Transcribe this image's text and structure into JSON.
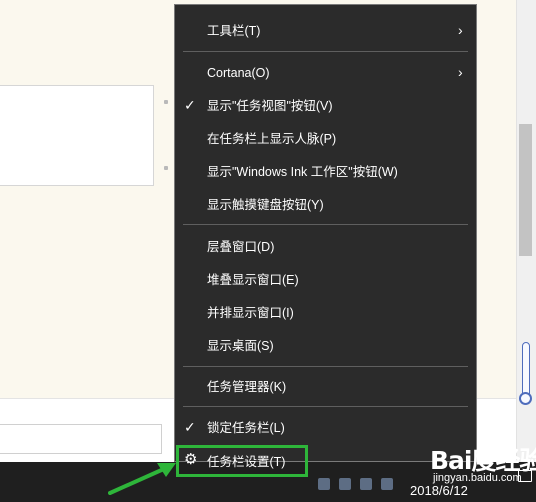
{
  "context_menu": {
    "items": [
      {
        "label": "工具栏(T)",
        "submenu": true
      },
      {
        "label": "Cortana(O)",
        "submenu": true
      },
      {
        "label": "显示\"任务视图\"按钮(V)",
        "checked": true
      },
      {
        "label": "在任务栏上显示人脉(P)"
      },
      {
        "label": "显示\"Windows Ink 工作区\"按钮(W)"
      },
      {
        "label": "显示触摸键盘按钮(Y)"
      },
      {
        "label": "层叠窗口(D)"
      },
      {
        "label": "堆叠显示窗口(E)"
      },
      {
        "label": "并排显示窗口(I)"
      },
      {
        "label": "显示桌面(S)"
      },
      {
        "label": "任务管理器(K)"
      },
      {
        "label": "锁定任务栏(L)",
        "checked": true
      },
      {
        "label": "任务栏设置(T)",
        "icon": "gear-icon"
      }
    ],
    "check_glyph": "✓",
    "arrow_glyph": "›",
    "gear_glyph": "⚙"
  },
  "taskbar": {
    "clock": "2018/6/12"
  },
  "watermark": {
    "brand": "Bai度经验",
    "url": "jingyan.baidu.com"
  },
  "colors": {
    "menu_bg": "#2b2b2b",
    "menu_text": "#ffffff",
    "highlight": "#2eb53a",
    "taskbar": "#1f1f1f"
  }
}
